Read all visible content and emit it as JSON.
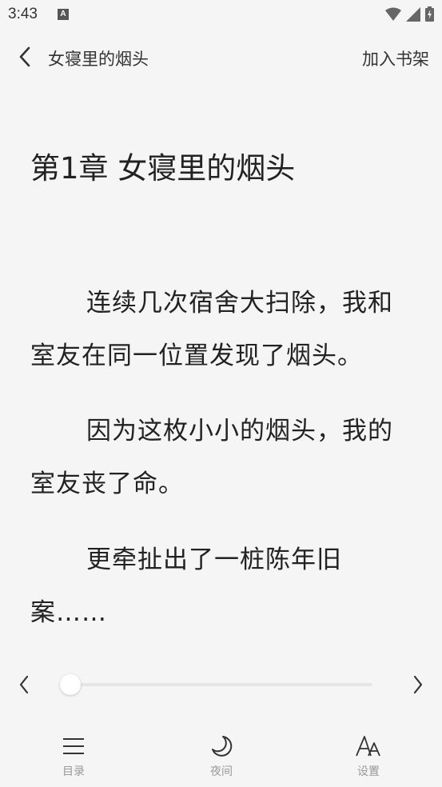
{
  "status_bar": {
    "time": "3:43",
    "notification_letter": "A",
    "icons": [
      "wifi-icon",
      "signal-icon",
      "battery-icon"
    ]
  },
  "header": {
    "back_icon": "chevron-left-icon",
    "book_title": "女寝里的烟头",
    "add_to_shelf": "加入书架"
  },
  "chapter": {
    "title": "第1章 女寝里的烟头",
    "paragraphs": [
      "连续几次宿舍大扫除，我和室友在同一位置发现了烟头。",
      "因为这枚小小的烟头，我的室友丧了命。",
      "更牵扯出了一桩陈年旧案……"
    ]
  },
  "progress": {
    "prev_icon": "chevron-left-icon",
    "next_icon": "chevron-right-icon",
    "value": 0
  },
  "bottom_nav": {
    "items": [
      {
        "label": "目录",
        "icon": "menu-icon"
      },
      {
        "label": "夜间",
        "icon": "moon-icon"
      },
      {
        "label": "设置",
        "icon": "font-size-icon"
      }
    ]
  },
  "colors": {
    "background": "#f5f5f5",
    "text": "#222222",
    "muted": "#999999"
  }
}
